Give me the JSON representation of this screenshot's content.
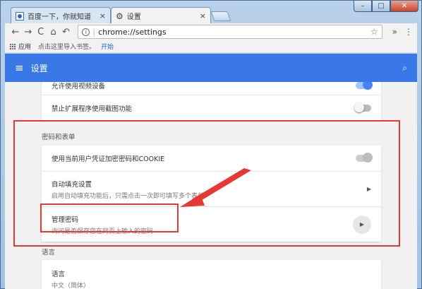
{
  "tabs": [
    {
      "title": "百度一下，你就知道",
      "close": "×"
    },
    {
      "title": "设置",
      "close": "×"
    }
  ],
  "window_controls": {
    "minimize": "–",
    "maximize": "□",
    "close": "✕"
  },
  "toolbar": {
    "back": "←",
    "forward": "→",
    "reload": "C",
    "home": "⌂",
    "undo": "↶",
    "url": "chrome://settings",
    "star": "☆",
    "extensions": "»",
    "menu": "⋮"
  },
  "bookmarks": {
    "apps": "应用",
    "hint": "点击这里导入书签。",
    "start": "开始"
  },
  "appbar": {
    "title": "设置",
    "menu_icon": "≡",
    "search_icon": "🔍"
  },
  "settings": {
    "row_video": "允许使用视频设备",
    "row_ext_screenshot": "禁止扩展程序使用截图功能",
    "section_passwords": "密码和表单",
    "row_cookie": "使用当前用户凭证加密密码和COOKIE",
    "autofill": {
      "title": "自动填充设置",
      "desc": "启用自动填充功能后，只需点击一次即可填写多个表单"
    },
    "manage_passwords": {
      "title": "管理密码",
      "desc": "询问是否保存您在网页上输入的密码"
    },
    "section_language": "语言",
    "row_language": "语言",
    "row_language_value": "中文（简体）"
  },
  "colors": {
    "accent": "#3b78e7",
    "annotation": "#e53935"
  }
}
